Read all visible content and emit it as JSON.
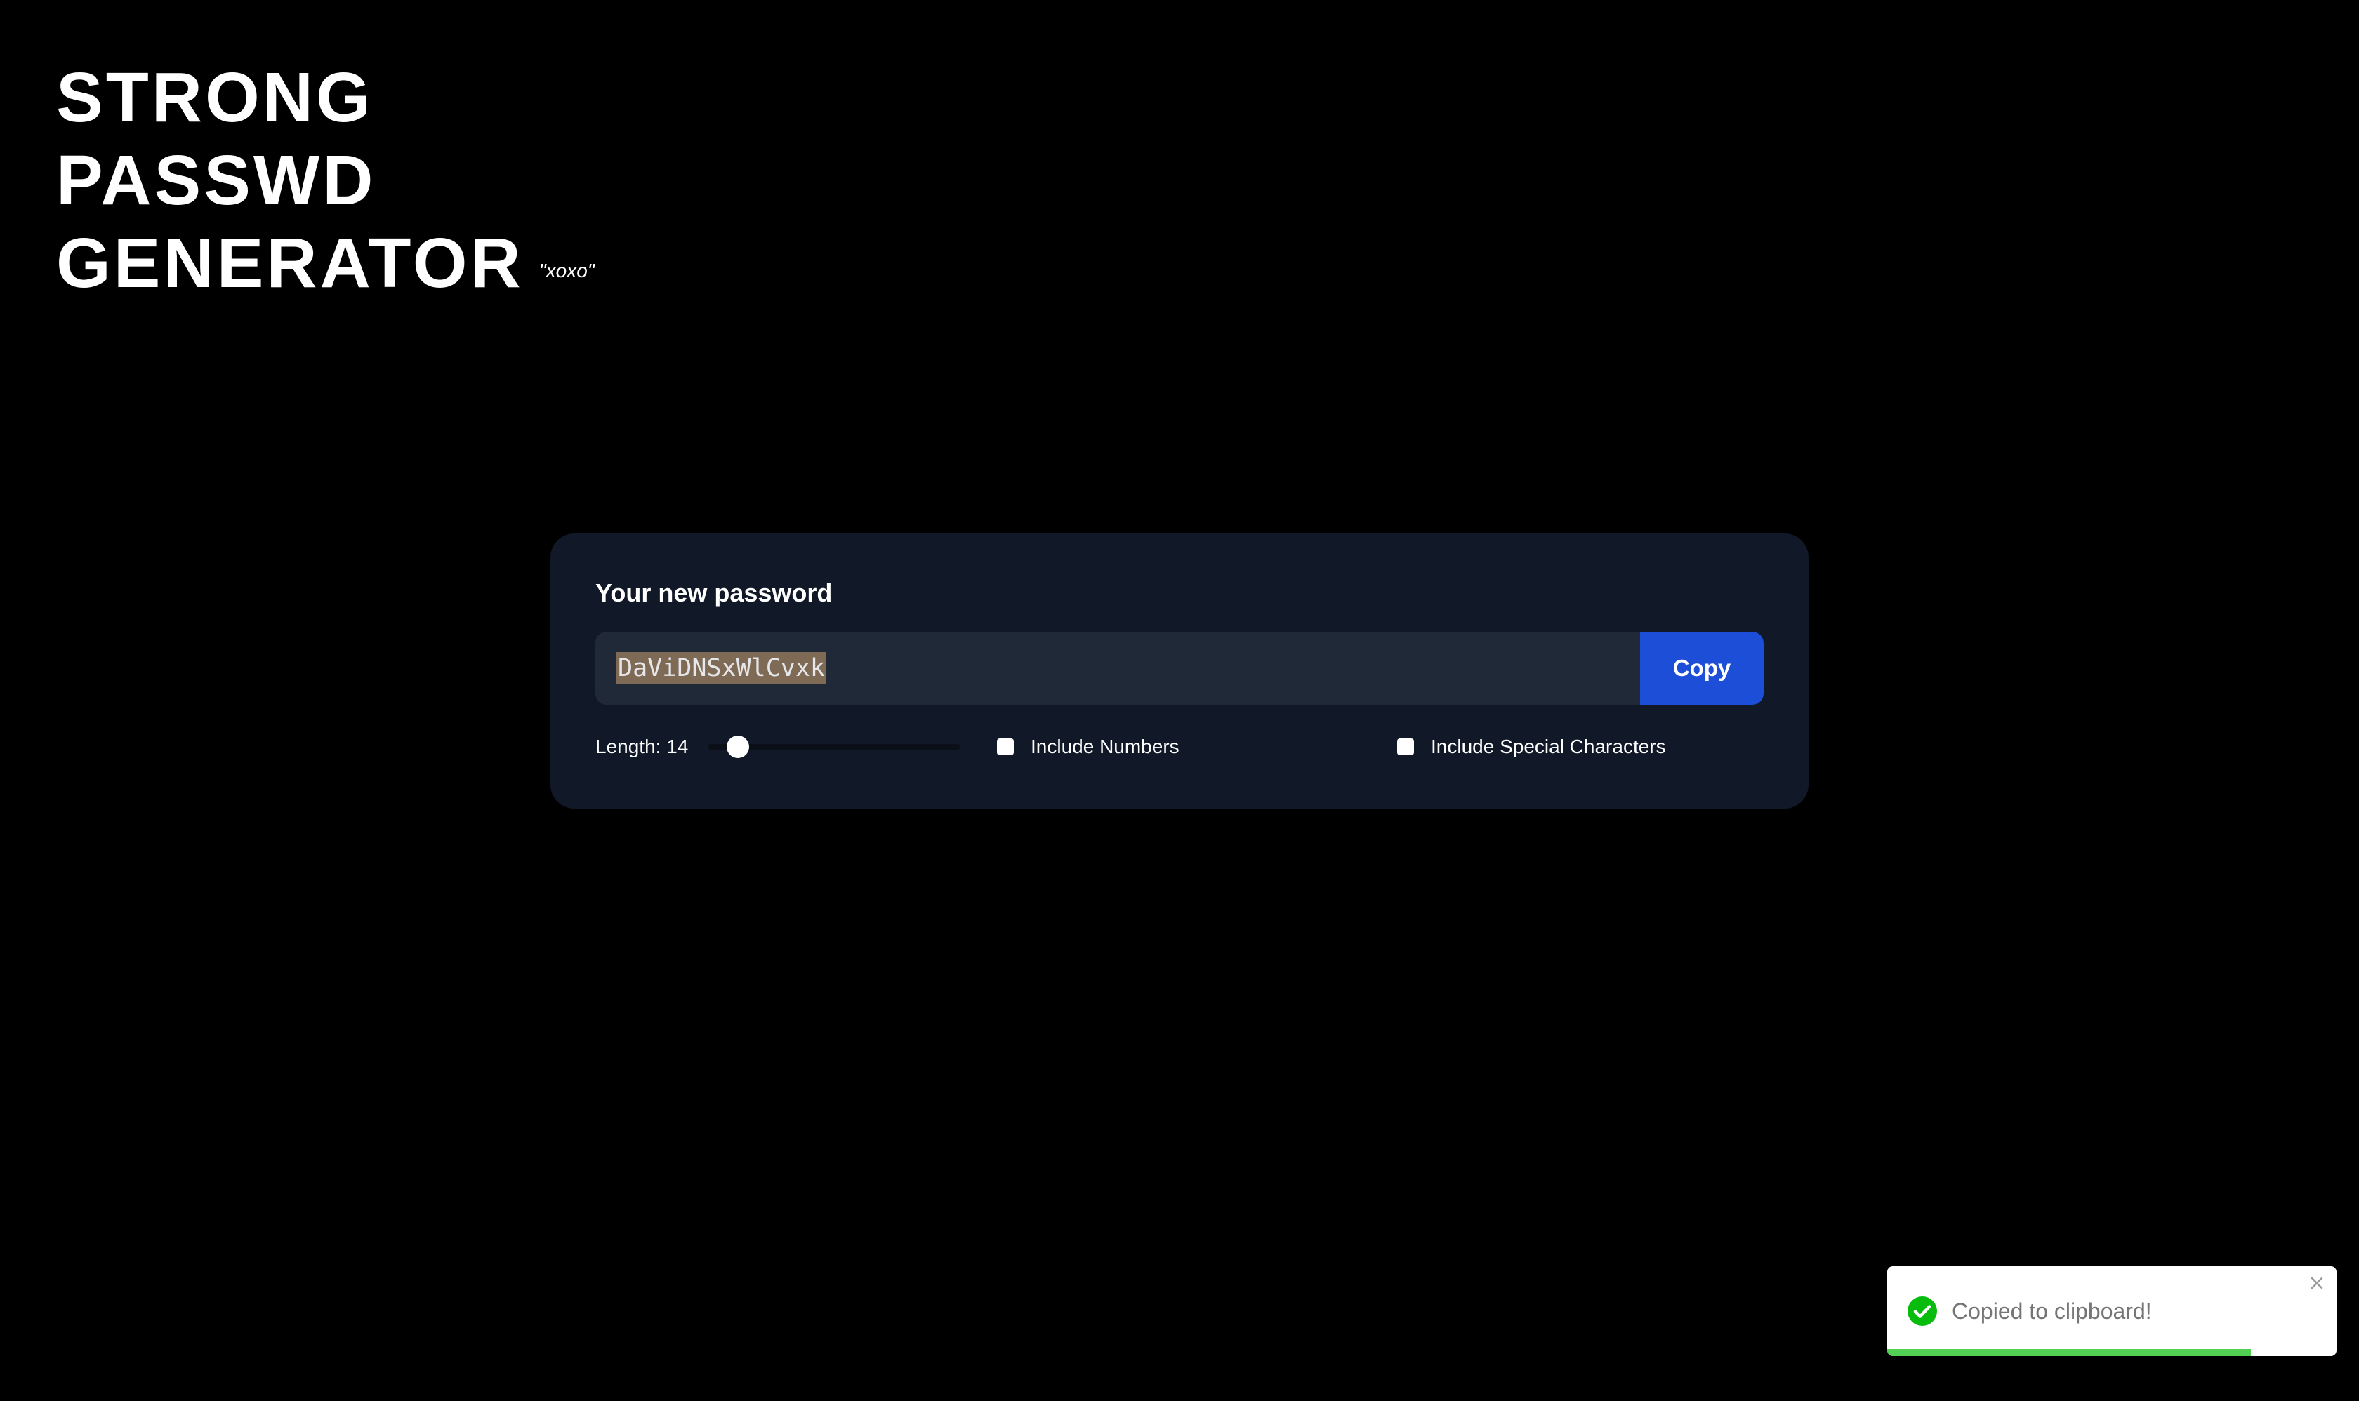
{
  "brand": {
    "line1": "STRONG",
    "line2": "PASSWD",
    "line3": "GENERATOR",
    "tagline": "\"xoxo\""
  },
  "card": {
    "heading": "Your new password",
    "password": "DaViDNSxWlCvxk",
    "copy_label": "Copy"
  },
  "options": {
    "length_label": "Length: 14",
    "length_value": 14,
    "length_slider_fraction": 0.12,
    "include_numbers_label": "Include Numbers",
    "include_numbers_checked": false,
    "include_special_label": "Include Special Characters",
    "include_special_checked": false
  },
  "toast": {
    "message": "Copied to clipboard!",
    "icon": "check-circle-icon",
    "progress_fraction": 0.81
  },
  "colors": {
    "background": "#000000",
    "card": "#111827",
    "field": "#1f2937",
    "accent": "#1d4ed8",
    "success": "#07bc0c"
  }
}
